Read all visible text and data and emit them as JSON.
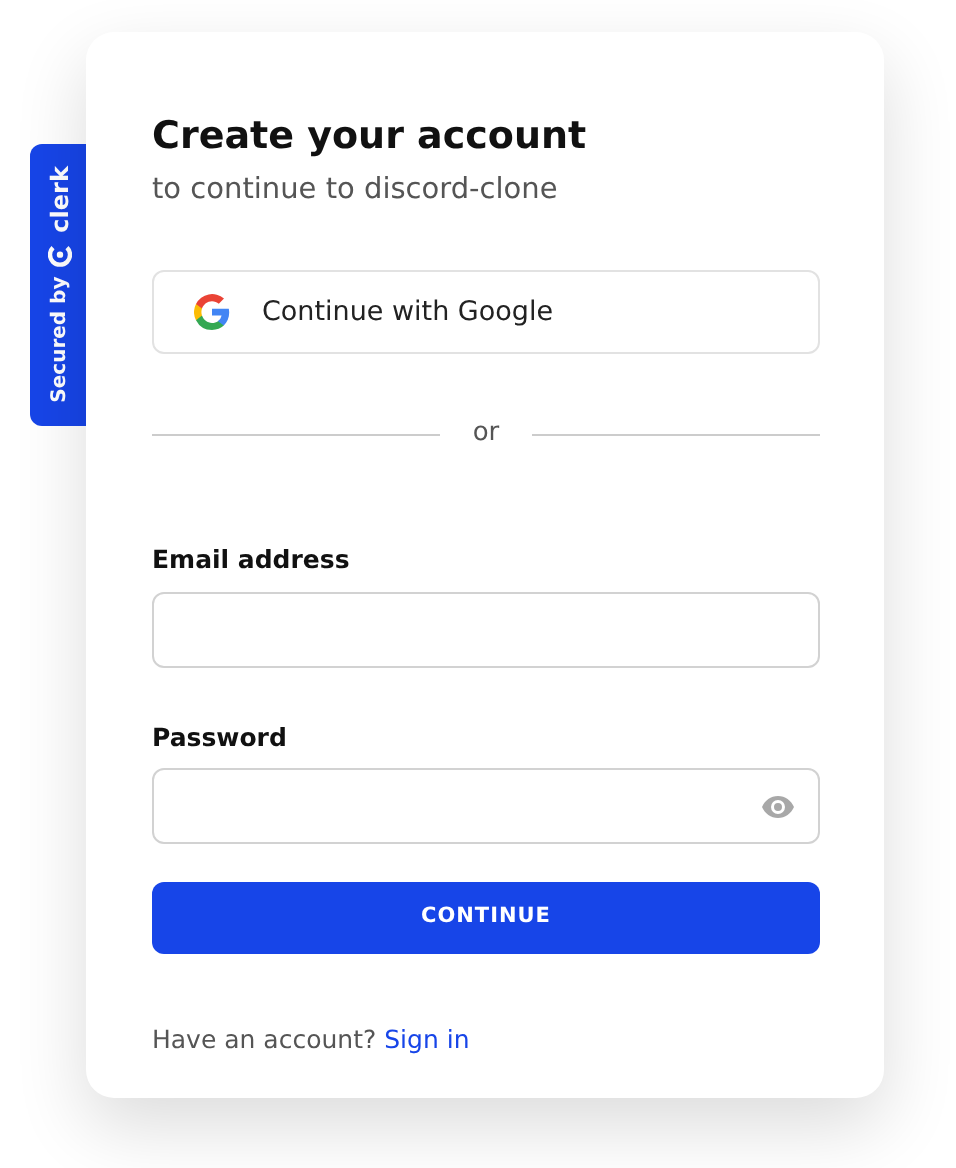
{
  "badge": {
    "prefix": "Secured by",
    "brand": "clerk"
  },
  "title": "Create your account",
  "subtitle": "to continue to discord-clone",
  "social_button": {
    "label": "Continue with Google"
  },
  "divider": "or",
  "fields": [
    {
      "label": "Email address",
      "kind": "text"
    },
    {
      "label": "Password",
      "kind": "password"
    }
  ],
  "submit": "CONTINUE",
  "footer": {
    "text": "Have an account?",
    "link": "Sign in"
  }
}
